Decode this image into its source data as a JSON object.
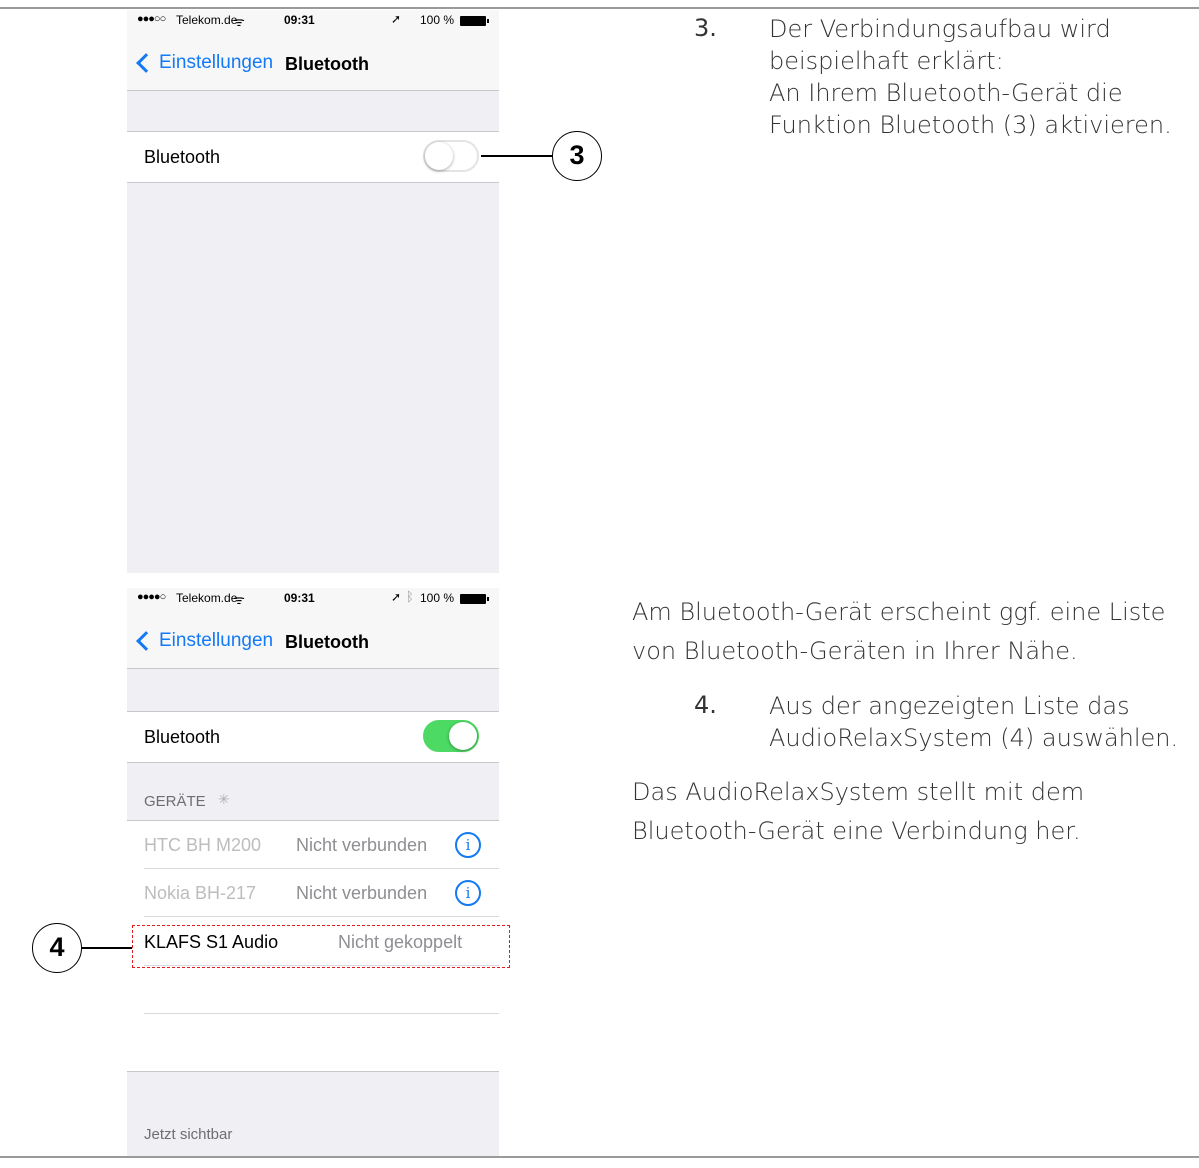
{
  "screen1": {
    "status": {
      "signal": "●●●○○",
      "carrier": "Telekom.de",
      "time": "09:31",
      "battery": "100 %"
    },
    "nav": {
      "back_label": "Einstellungen",
      "title": "Bluetooth"
    },
    "bluetooth_row": {
      "label": "Bluetooth",
      "toggle_on": false
    }
  },
  "screen2": {
    "status": {
      "signal": "●●●●○",
      "carrier": "Telekom.de",
      "time": "09:31",
      "battery": "100 %"
    },
    "nav": {
      "back_label": "Einstellungen",
      "title": "Bluetooth"
    },
    "bluetooth_row": {
      "label": "Bluetooth",
      "toggle_on": true
    },
    "devices_header": "GERÄTE",
    "devices": [
      {
        "name": "HTC BH M200",
        "state": "Nicht verbunden",
        "info": "i"
      },
      {
        "name": "Nokia BH-217",
        "state": "Nicht verbunden",
        "info": "i"
      },
      {
        "name": "KLAFS S1 Audio",
        "state": "Nicht gekoppelt"
      }
    ],
    "footer": "Jetzt sichtbar"
  },
  "callouts": {
    "c3": "3",
    "c4": "4"
  },
  "text": {
    "step3_number": "3.",
    "step3_line1": "Der Verbindungsaufbau wird",
    "step3_line2": "beispielhaft erklärt:",
    "step3_line3": "An Ihrem Bluetooth-Gerät die",
    "step3_line4": "Funktion Bluetooth (3) aktivieren.",
    "para1_line1": "Am Bluetooth-Gerät erscheint ggf. eine Liste",
    "para1_line2": "von Bluetooth-Geräten in Ihrer Nähe.",
    "step4_number": "4.",
    "step4_line1": "Aus der angezeigten Liste das",
    "step4_line2": "AudioRelaxSystem (4) auswählen.",
    "para2_line1": "Das AudioRelaxSystem stellt mit dem",
    "para2_line2": "Bluetooth-Gerät eine Verbindung her."
  },
  "colors": {
    "ios_blue": "#1479f5",
    "toggle_green": "#4cd964",
    "highlight_red": "#e21c1c"
  }
}
